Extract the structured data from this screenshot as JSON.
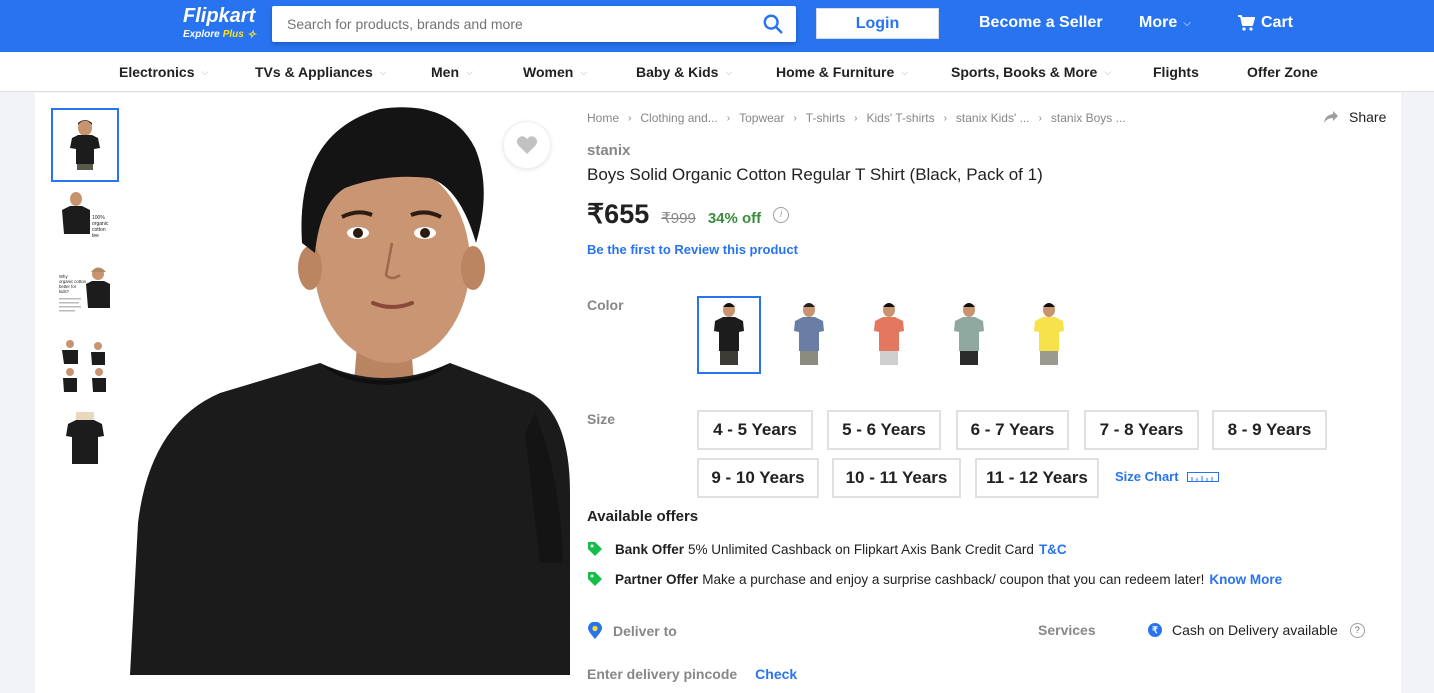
{
  "header": {
    "logo_name": "Flipkart",
    "logo_sub": "Explore",
    "logo_plus": "Plus",
    "search_placeholder": "Search for products, brands and more",
    "login_label": "Login",
    "seller_label": "Become a Seller",
    "more_label": "More",
    "cart_label": "Cart",
    "brand_color": "#2874f0"
  },
  "categories": [
    "Electronics",
    "TVs & Appliances",
    "Men",
    "Women",
    "Baby & Kids",
    "Home & Furniture",
    "Sports, Books & More",
    "Flights",
    "Offer Zone"
  ],
  "breadcrumbs": [
    "Home",
    "Clothing and...",
    "Topwear",
    "T-shirts",
    "Kids' T-shirts",
    "stanix Kids' ...",
    "stanix Boys ..."
  ],
  "share_label": "Share",
  "product": {
    "brand": "stanix",
    "title": "Boys Solid Organic Cotton Regular T Shirt  (Black, Pack of 1)",
    "price": "₹655",
    "mrp": "₹999",
    "discount": "34% off",
    "review_link": "Be the first to Review this product"
  },
  "color_label": "Color",
  "colors": [
    "black",
    "blue-grey",
    "coral",
    "sage",
    "yellow"
  ],
  "size_label": "Size",
  "sizes": [
    "4 - 5 Years",
    "5 - 6 Years",
    "6 - 7 Years",
    "7 - 8 Years",
    "8 - 9 Years",
    "9 - 10 Years",
    "10 - 11 Years",
    "11 - 12 Years"
  ],
  "size_chart_label": "Size Chart",
  "offers": {
    "title": "Available offers",
    "items": [
      {
        "kind": "Bank Offer",
        "text": "5% Unlimited Cashback on Flipkart Axis Bank Credit Card",
        "link": "T&C"
      },
      {
        "kind": "Partner Offer",
        "text": "Make a purchase and enjoy a surprise cashback/ coupon that you can redeem later!",
        "link": "Know More"
      }
    ]
  },
  "delivery": {
    "deliver_to": "Deliver to",
    "services": "Services",
    "cod": "Cash on Delivery available",
    "pincode_placeholder": "Enter delivery pincode",
    "check": "Check"
  },
  "thumbnail_texts": {
    "thumb2": [
      "100%",
      "organic",
      "cotton",
      "tee"
    ],
    "thumb3": [
      "Why",
      "organic cotton",
      "better for",
      "kids?"
    ]
  }
}
